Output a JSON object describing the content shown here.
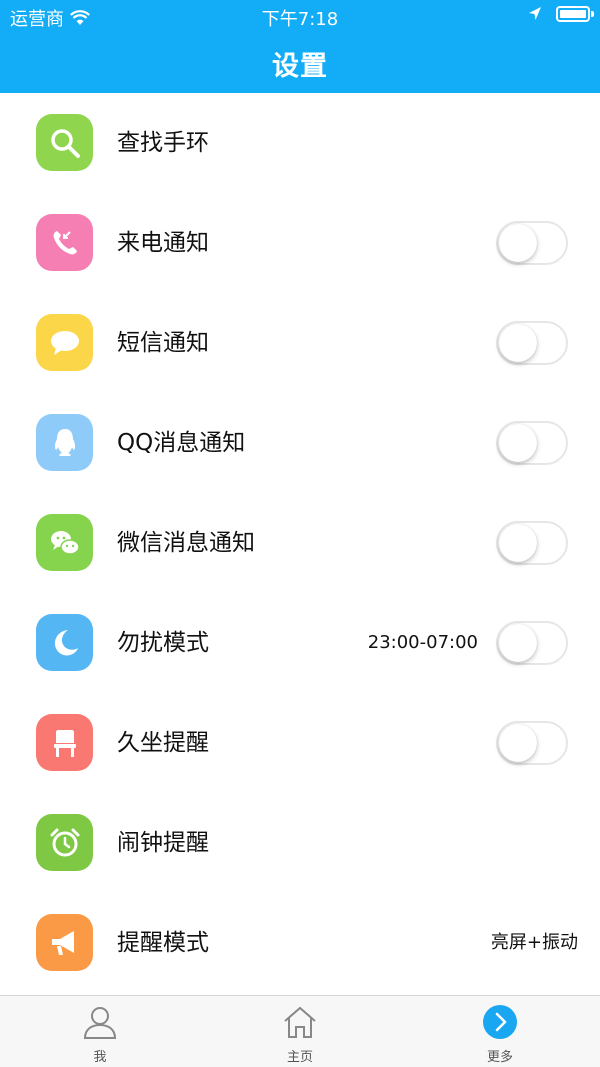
{
  "status_bar": {
    "carrier": "运营商",
    "time": "下午7:18"
  },
  "header": {
    "title": "设置"
  },
  "items": [
    {
      "label": "查找手环",
      "icon": "search-icon",
      "color": "#8fd54d"
    },
    {
      "label": "来电通知",
      "icon": "phone-icon",
      "color": "#f57eb3",
      "toggle": false
    },
    {
      "label": "短信通知",
      "icon": "message-bubble-icon",
      "color": "#fbd648",
      "toggle": false
    },
    {
      "label": "QQ消息通知",
      "icon": "qq-penguin-icon",
      "color": "#8ecbf8",
      "toggle": false
    },
    {
      "label": "微信消息通知",
      "icon": "wechat-icon",
      "color": "#86d34e",
      "toggle": false
    },
    {
      "label": "勿扰模式",
      "icon": "moon-icon",
      "color": "#55b6f4",
      "value": "23:00-07:00",
      "toggle": false
    },
    {
      "label": "久坐提醒",
      "icon": "chair-icon",
      "color": "#f97872",
      "toggle": false
    },
    {
      "label": "闹钟提醒",
      "icon": "alarm-clock-icon",
      "color": "#7fc843"
    },
    {
      "label": "提醒模式",
      "icon": "megaphone-icon",
      "color": "#fb9a46",
      "value": "亮屏+振动"
    }
  ],
  "tabbar": {
    "me": "我",
    "home": "主页",
    "more": "更多",
    "active_color": "#1aa7f2"
  },
  "colors": {
    "header_bg": "#13adf7"
  }
}
